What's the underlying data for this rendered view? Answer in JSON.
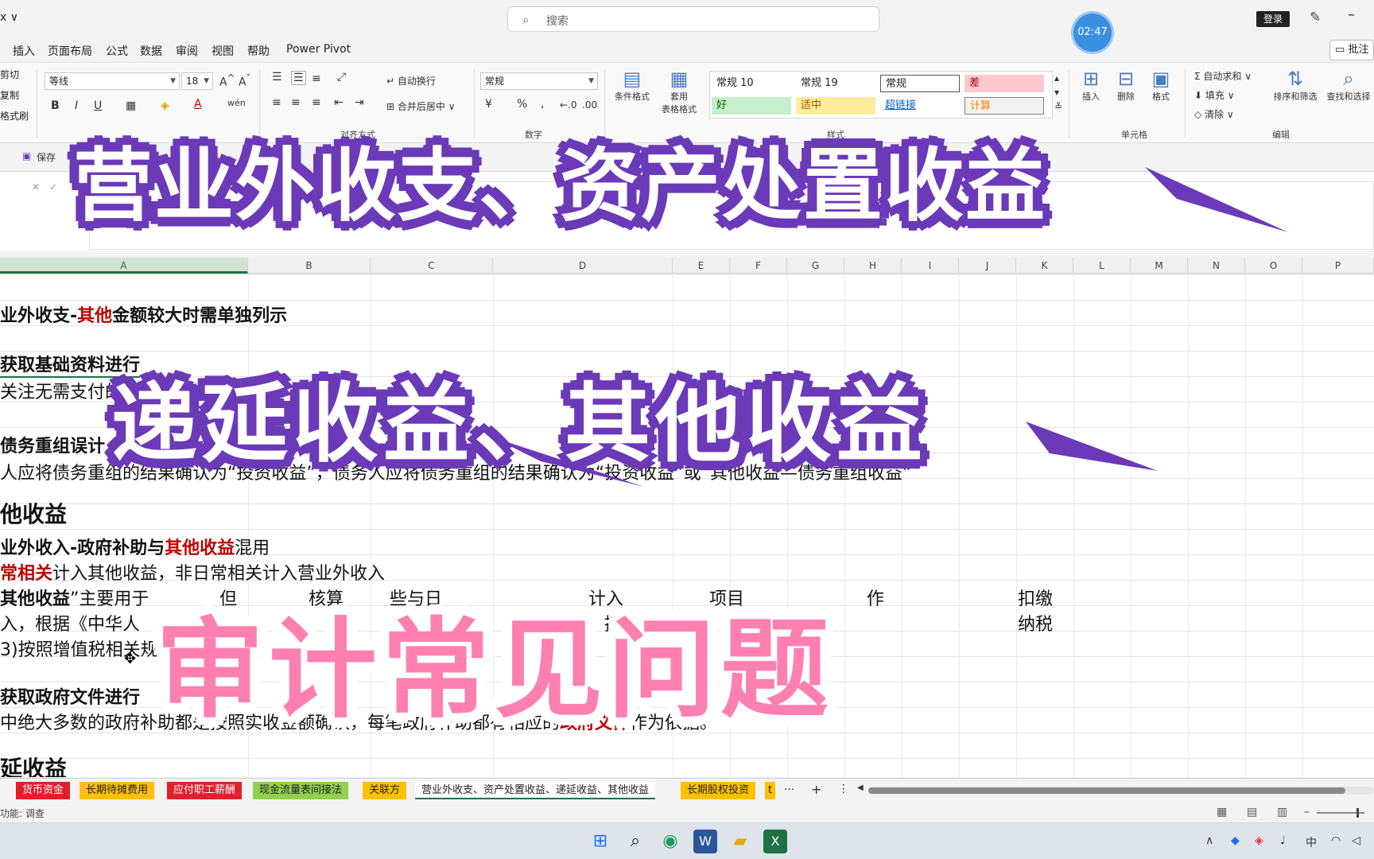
{
  "window": {
    "filename": "x ∨",
    "search_placeholder": "搜索",
    "timer": "02:47",
    "login_label": "登录",
    "minimize": "–"
  },
  "menu": {
    "tabs": [
      "插入",
      "页面布局",
      "公式",
      "数据",
      "审阅",
      "视图",
      "帮助",
      "Power Pivot"
    ],
    "comment_label": "批注"
  },
  "ribbon": {
    "clipboard": [
      "剪切",
      "复制",
      "格式刷"
    ],
    "font_name": "等线",
    "font_size": "18",
    "wrap_label": "自动换行",
    "merge_label": "合并后居中",
    "align_group": "对齐方式",
    "number_group": "数字",
    "number_format": "常规",
    "cond_format": "条件格式",
    "table_format_1": "套用",
    "table_format_2": "表格格式",
    "styles": {
      "normal10": "常规 10",
      "normal19": "常规 19",
      "normal": "常规",
      "bad": "差",
      "good": "好",
      "neutral": "适中",
      "hyperlink": "超链接",
      "calc": "计算"
    },
    "insert": "插入",
    "delete": "删除",
    "format": "格式",
    "autosum": "自动求和",
    "fill": "填充",
    "clear": "清除",
    "sort_filter": "排序和筛选",
    "find_select": "查找和选择",
    "edit_group": "编辑",
    "cells_group": "单元格",
    "styles_group": "样式"
  },
  "quickbar": {
    "save": "保存"
  },
  "columns": [
    "A",
    "B",
    "C",
    "D",
    "E",
    "F",
    "G",
    "H",
    "I",
    "J",
    "K",
    "L",
    "M",
    "N",
    "O",
    "P"
  ],
  "rows": {
    "r1_a": "业外收支-",
    "r1_b": "其他",
    "r1_c": "金额较大时需单独列示",
    "r2": "获取基础资料进行",
    "r3": "关注无需支付的",
    "r4": "债务重组误计",
    "r5": "人应将债务重组的结果确认为“投资收益”，债务人应将债务重组的结果确认为“投资收益”或“其他收益—债务重组收益”",
    "r6": "他收益",
    "r7_a": "业外收入-政府补助与",
    "r7_b": "其他收益",
    "r7_c": "混用",
    "r8_a": "常相关",
    "r8_b": "计入其他收益，非日常相关计入营业外收入",
    "r9_a": "其他收益",
    "r9_b": "”主要用于",
    "r9_c": "但",
    "r9_d": "核算",
    "r9_e": "些与日",
    "r9_f": "计入",
    "r9_g": "项目",
    "r9_h": "作",
    "r9_i": "扣缴",
    "r10_a": "入，根据《中华人",
    "r10_b": "接",
    "r10_c": "规",
    "r10_d": "纳税",
    "r11_a": "3)按照增值税相关规",
    "r11_b": "直",
    "r12": "获取政府文件进行",
    "r13_a": "中绝大多数的政府补助都是按照实收金额确认，每笔政府补助都有相应的",
    "r13_b": "政府文件",
    "r13_c": "作为依据。",
    "r14": "延收益"
  },
  "sheets": [
    {
      "name": "货币资金",
      "color": "#e0202a",
      "text": "#ffffff"
    },
    {
      "name": "长期待摊费用",
      "color": "#ffc000",
      "text": "#222222"
    },
    {
      "name": "应付职工薪酬",
      "color": "#e0202a",
      "text": "#ffffff"
    },
    {
      "name": "现金流量表间接法",
      "color": "#92d050",
      "text": "#222222"
    },
    {
      "name": "关联方",
      "color": "#ffc000",
      "text": "#222222"
    },
    {
      "name": "营业外收支、资产处置收益、递延收益、其他收益",
      "color": "#ffffff",
      "text": "#222222"
    },
    {
      "name": "长期股权投资",
      "color": "#ffc000",
      "text": "#222222"
    },
    {
      "name": "t",
      "color": "#ffc000",
      "text": "#222222"
    }
  ],
  "sheetbar": {
    "more": "···",
    "add": "+",
    "menu": "⋮"
  },
  "status": {
    "mode": "功能: 调查"
  },
  "tray": {
    "ime": "中"
  },
  "captions": {
    "line1": "营业外收支、资产处置收益",
    "line2": "递延收益、其他收益",
    "line3": "审计常见问题"
  },
  "colors": {
    "purple": "#6a3ab8",
    "pink": "#ff7fb1",
    "excel_green": "#1e7145"
  }
}
